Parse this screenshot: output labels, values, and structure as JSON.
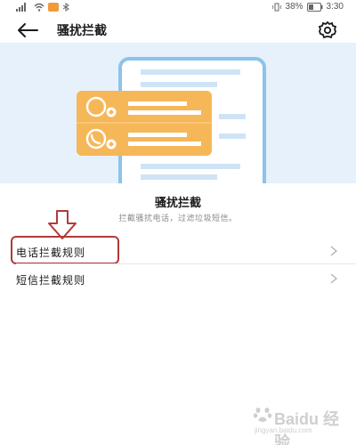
{
  "status_bar": {
    "battery_percent": "38%",
    "time": "3:30",
    "icons": [
      "signal-icon",
      "wifi-icon",
      "notification-badge-icon",
      "bluetooth-icon",
      "vibrate-icon",
      "battery-icon"
    ]
  },
  "header": {
    "title": "骚扰拦截",
    "back_icon": "back-arrow-icon",
    "settings_icon": "gear-icon"
  },
  "main": {
    "section_title": "骚扰拦截",
    "section_desc": "拦截骚扰电话，过滤垃圾短信。",
    "rules": [
      {
        "label": "电话拦截规则"
      },
      {
        "label": "短信拦截规则"
      }
    ]
  },
  "annotations": {
    "arrow_color": "#b23a3a",
    "highlight_color": "#b23a3a"
  },
  "watermark": {
    "logo_text": "Baidu 经验",
    "sub_text": "jingyan.baidu.com"
  },
  "colors": {
    "hero_bg": "#e6f1fb",
    "phone_frame": "#8cc3ea",
    "card_orange": "#f6b759"
  }
}
